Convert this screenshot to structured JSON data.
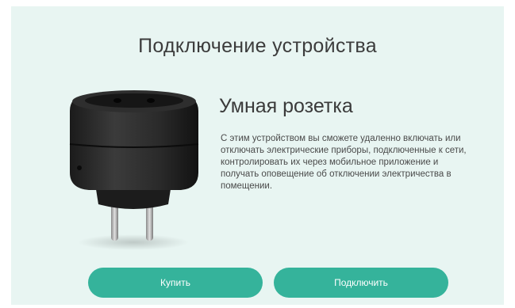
{
  "page": {
    "title": "Подключение устройства"
  },
  "device": {
    "name": "Умная розетка",
    "description": "С этим устройством вы сможете удаленно включать или отключать электрические приборы, подключенные к сети, контролировать их через мобильное приложение и получать оповещение об отключении электричества в помещении.",
    "image_icon": "smart-plug-image"
  },
  "actions": {
    "buy_label": "Купить",
    "connect_label": "Подключить"
  },
  "colors": {
    "background": "#e8f5f2",
    "accent": "#35b39b",
    "button_text": "#ffffff"
  }
}
